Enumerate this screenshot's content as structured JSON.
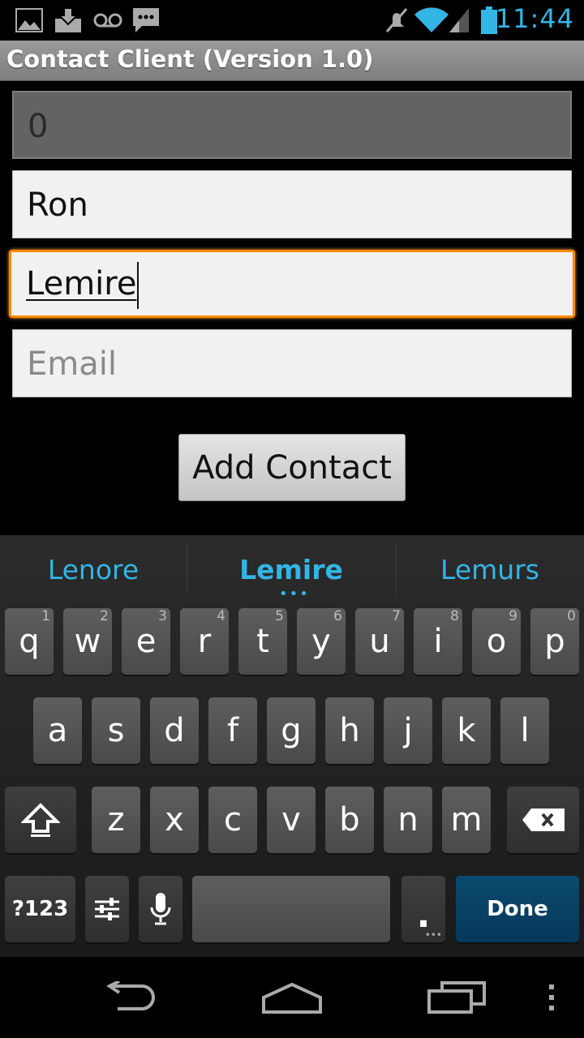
{
  "status_bar": {
    "time": "11:44",
    "icons": [
      "picture-icon",
      "download-icon",
      "voicemail-icon",
      "message-icon",
      "mute-icon",
      "wifi-icon",
      "signal-icon",
      "battery-icon"
    ]
  },
  "app": {
    "title": "Contact Client (Version 1.0)"
  },
  "form": {
    "id_value": "0",
    "first_name_value": "Ron",
    "last_name_value": "Lemire",
    "email_placeholder": "Email",
    "add_button_label": "Add Contact"
  },
  "keyboard": {
    "suggestions": [
      "Lenore",
      "Lemire",
      "Lemurs"
    ],
    "row1": [
      {
        "label": "q",
        "hint": "1"
      },
      {
        "label": "w",
        "hint": "2"
      },
      {
        "label": "e",
        "hint": "3"
      },
      {
        "label": "r",
        "hint": "4"
      },
      {
        "label": "t",
        "hint": "5"
      },
      {
        "label": "y",
        "hint": "6"
      },
      {
        "label": "u",
        "hint": "7"
      },
      {
        "label": "i",
        "hint": "8"
      },
      {
        "label": "o",
        "hint": "9"
      },
      {
        "label": "p",
        "hint": "0"
      }
    ],
    "row2": [
      "a",
      "s",
      "d",
      "f",
      "g",
      "h",
      "j",
      "k",
      "l"
    ],
    "row3": [
      "z",
      "x",
      "c",
      "v",
      "b",
      "n",
      "m"
    ],
    "symbols_label": "?123",
    "period_label": ".",
    "done_label": "Done"
  },
  "colors": {
    "accent": "#33b5e5",
    "focus": "#ff8a00",
    "done_key": "#06385a"
  }
}
